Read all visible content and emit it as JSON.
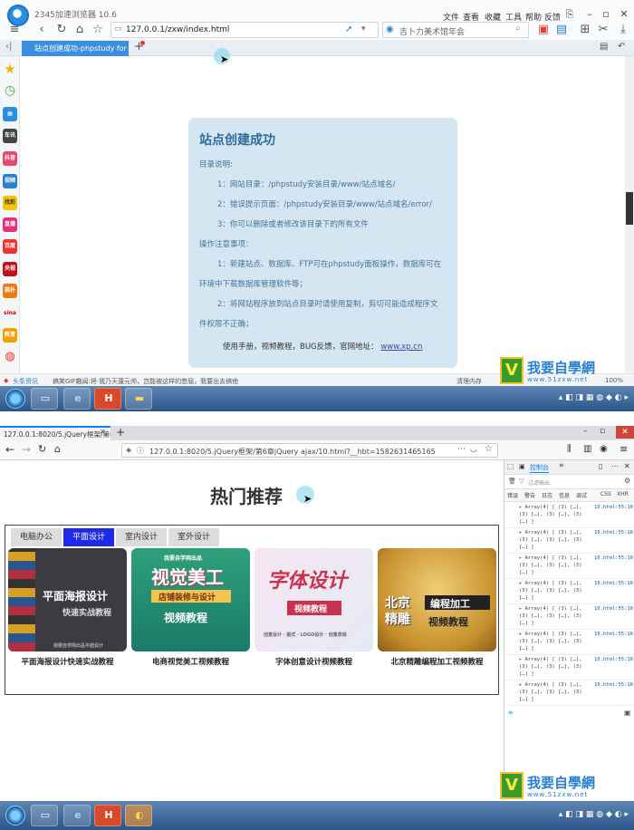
{
  "top_browser": {
    "app_name": "2345加速浏览器 10.6",
    "menu": [
      "文件",
      "查看",
      "收藏",
      "工具",
      "帮助",
      "反馈"
    ],
    "url": "127.0.0.1/zxw/index.html",
    "search_placeholder": "吉卜力美术馆年会",
    "tab_title": "站点创建成功-phpstudy for",
    "status_left": "头条资讯",
    "status_news": "搞笑GIF趣闻:将·我乃天蓬元帅，岂能被这样的憋屈，我要出去搞他",
    "status_memory": "清理内存",
    "status_zoom": "100%",
    "sidebar_labels": [
      "车讯",
      "抖音",
      "视频",
      "找彩",
      "直播",
      "百度",
      "央视",
      "猫扑",
      "sina",
      "教育"
    ]
  },
  "card": {
    "title": "站点创建成功",
    "section1": "目录说明:",
    "dir1": "1：网站目录：/phpstudy安装目录/www/站点域名/",
    "dir2": "2：错误提示页面：/phpstudy安装目录/www/站点域名/error/",
    "dir3": "3：你可以删除或者修改该目录下的所有文件",
    "section2": "操作注意事项：",
    "op1a": "1：新建站点、数据库、FTP可在phpstudy面板操作，数据库可在",
    "op1b": "环境中下载数据库管理软件等；",
    "op2a": "2：将网站程序放到站点目录时请使用复制，剪切可能造成程序文",
    "op2b": "件权限不正确；",
    "footer": "使用手册，视频教程，BUG反馈，官网地址：",
    "footer_link": "www.xp.cn"
  },
  "watermark": {
    "text": "我要自學網",
    "url": "www.51zxw.net"
  },
  "bottom_browser": {
    "tab_title": "127.0.0.1:8020/5.jQuery框架/第6",
    "url": "127.0.0.1:8020/5.jQuery框架/第6章jQuery ajax/10.html?__hbt=1582631465165",
    "page_title": "热门推荐",
    "tabs": [
      "电脑办公",
      "平面设计",
      "室内设计",
      "室外设计"
    ],
    "products": [
      {
        "caption": "平面海报设计快速实战教程",
        "img_line1": "平面海报设计",
        "img_line2": "快速实战教程",
        "img_footer": "我要自学网出品平面设计"
      },
      {
        "caption": "电商视觉美工视频教程",
        "img_top": "我要自学网出品",
        "img_line1": "视觉美工",
        "img_line2": "店铺装修与设计",
        "img_line3": "视频教程"
      },
      {
        "caption": "字体创意设计视频教程",
        "img_line1": "字体设计",
        "img_line2": "视频教程",
        "img_footer": "创意设计 · 版式 · LOGO设计 · 创意表现"
      },
      {
        "caption": "北京精雕编程加工视频教程",
        "img_line1": "北京",
        "img_line2": "精雕",
        "img_line3": "编程加工",
        "img_line4": "视频教程"
      }
    ]
  },
  "devtools": {
    "tab_console": "控制台",
    "filter_placeholder": "过滤输出",
    "levels": [
      "错误",
      "警告",
      "日志",
      "信息",
      "调试",
      "CSS",
      "XHR"
    ],
    "logs": [
      {
        "line1": "▸ Array(4) [ (3) […],",
        "line2": "(3) […], (3) […], (3)",
        "line3": "[…] ]",
        "src": "10.html:55:16"
      },
      {
        "line1": "▸ Array(4) [ (3) […],",
        "line2": "(3) […], (3) […], (3)",
        "line3": "[…] ]",
        "src": "10.html:55:16"
      },
      {
        "line1": "▸ Array(4) [ (3) […],",
        "line2": "(3) […], (3) […], (3)",
        "line3": "[…] ]",
        "src": "10.html:55:16"
      },
      {
        "line1": "▸ Array(4) [ (3) […],",
        "line2": "(3) […], (3) […], (3)",
        "line3": "[…] ]",
        "src": "10.html:55:16"
      },
      {
        "line1": "▸ Array(4) [ (3) […],",
        "line2": "(3) […], (3) […], (3)",
        "line3": "[…] ]",
        "src": "10.html:55:16"
      },
      {
        "line1": "▸ Array(4) [ (3) […],",
        "line2": "(3) […], (3) […], (3)",
        "line3": "[…] ]",
        "src": "10.html:55:16"
      },
      {
        "line1": "▸ Array(4) [ (3) […],",
        "line2": "(3) […], (3) […], (3)",
        "line3": "[…] ]",
        "src": "10.html:55:16"
      },
      {
        "line1": "▸ Array(4) [ (3) […],",
        "line2": "(3) […], (3) […], (3)",
        "line3": "[…] ]",
        "src": "10.html:55:16"
      }
    ]
  }
}
